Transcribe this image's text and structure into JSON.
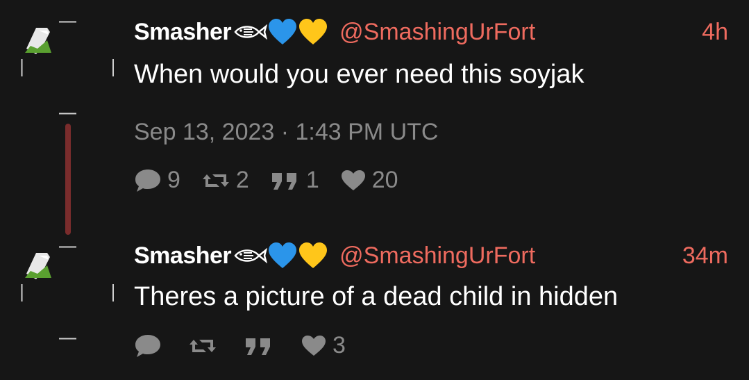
{
  "colors": {
    "background": "#161616",
    "accent": "#ef6b5f",
    "muted": "#8a8a8a",
    "thread_line": "#7a2c2c"
  },
  "tweets": [
    {
      "display_name": "Smasher",
      "name_emojis": [
        "fish-icon",
        "blue-heart-icon",
        "yellow-heart-icon"
      ],
      "handle": "@SmashingUrFort",
      "time": "4h",
      "text": "When would you ever need this soyjak",
      "date": "Sep 13, 2023 · 1:43 PM UTC",
      "stats": {
        "replies": "9",
        "retweets": "2",
        "quotes": "1",
        "likes": "20"
      }
    },
    {
      "display_name": "Smasher",
      "name_emojis": [
        "fish-icon",
        "blue-heart-icon",
        "yellow-heart-icon"
      ],
      "handle": "@SmashingUrFort",
      "time": "34m",
      "text": "Theres a picture of a dead child in hidden",
      "stats": {
        "replies": "",
        "retweets": "",
        "quotes": "",
        "likes": "3"
      }
    }
  ]
}
